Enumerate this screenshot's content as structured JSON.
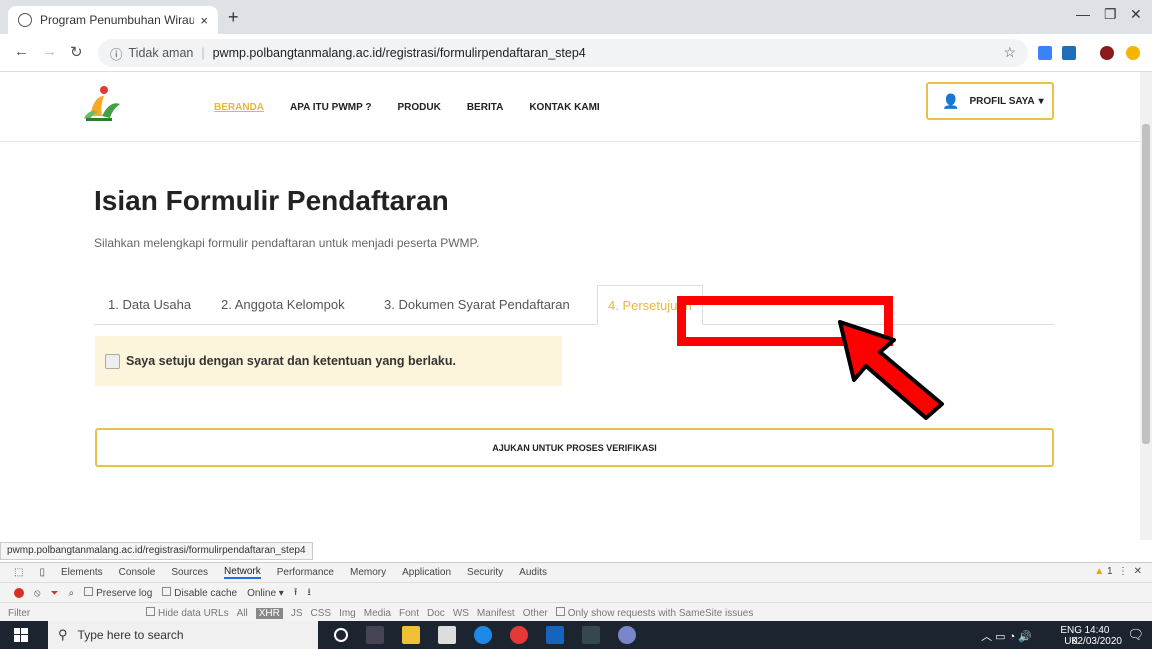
{
  "browser": {
    "tab_title": "Program Penumbuhan Wirausaha",
    "tab_close": "×",
    "new_tab": "+",
    "security_label": "Tidak aman",
    "url": "pwmp.polbangtanmalang.ac.id/registrasi/formulirpendaftaran_step4",
    "status_url": "pwmp.polbangtanmalang.ac.id/registrasi/formulirpendaftaran_step4"
  },
  "site": {
    "menu": [
      "BERANDA",
      "APA ITU PWMP ?",
      "PRODUK",
      "BERITA",
      "KONTAK KAMI"
    ],
    "profile_label": "PROFIL SAYA"
  },
  "form": {
    "title": "Isian Formulir Pendaftaran",
    "subtitle": "Silahkan melengkapi formulir pendaftaran untuk menjadi peserta PWMP.",
    "tabs": [
      "1. Data Usaha",
      "2. Anggota Kelompok",
      "3. Dokumen Syarat Pendaftaran",
      "4. Persetujuan"
    ],
    "active_tab": 3,
    "agree_text": "Saya setuju dengan syarat dan ketentuan yang berlaku.",
    "agree_checked": false,
    "submit_label": "AJUKAN UNTUK PROSES VERIFIKASI"
  },
  "devtools": {
    "panels": [
      "Elements",
      "Console",
      "Sources",
      "Network",
      "Performance",
      "Memory",
      "Application",
      "Security",
      "Audits"
    ],
    "selected_panel": "Network",
    "options": [
      "Preserve log",
      "Disable cache",
      "Online"
    ],
    "filter_placeholder": "Filter",
    "hide_data_urls": "Hide data URLs",
    "filters": [
      "All",
      "XHR",
      "JS",
      "CSS",
      "Img",
      "Media",
      "Font",
      "Doc",
      "WS",
      "Manifest",
      "Other"
    ],
    "samesite": "Only show requests with SameSite issues",
    "warning_count": "1"
  },
  "taskbar": {
    "search_placeholder": "Type here to search",
    "lang": "ENG",
    "region": "UK",
    "time": "14:40",
    "date": "02/03/2020",
    "notif_count": "6"
  },
  "colors": {
    "accent": "#e9b83a",
    "annotation": "#ff0000"
  }
}
